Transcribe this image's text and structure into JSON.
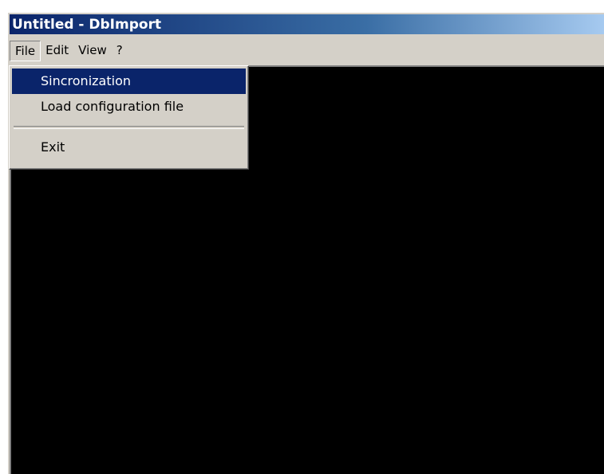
{
  "window": {
    "title": "Untitled - DbImport"
  },
  "menubar": {
    "items": [
      {
        "label": "File"
      },
      {
        "label": "Edit"
      },
      {
        "label": "View"
      },
      {
        "label": "?"
      }
    ]
  },
  "file_menu": {
    "items": [
      {
        "label": "Sincronization"
      },
      {
        "label": "Load configuration file"
      },
      {
        "label": "Exit"
      }
    ]
  },
  "colors": {
    "titlebar_start": "#0a246a",
    "titlebar_end": "#a6caf0",
    "face": "#d4d0c8",
    "highlight": "#0a246a",
    "client_area": "#000000"
  }
}
